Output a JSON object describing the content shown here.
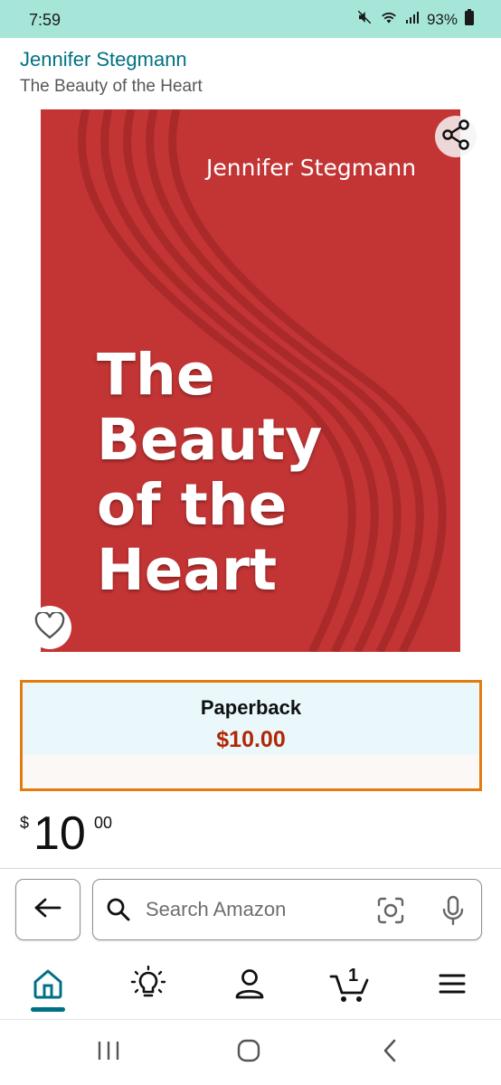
{
  "status_bar": {
    "time": "7:59",
    "battery": "93%",
    "icons": [
      "mute-icon",
      "wifi-icon",
      "signal-icon",
      "battery-icon"
    ],
    "background": "#a6e6d9"
  },
  "product": {
    "author": "Jennifer Stegmann",
    "title": "The Beauty of the Heart",
    "cover": {
      "author": "Jennifer Stegmann",
      "title": "The\nBeauty\nof the\nHeart",
      "background": "#c33434"
    }
  },
  "format": {
    "label": "Paperback",
    "price": "$10.00",
    "border_color": "#e27c0e"
  },
  "price": {
    "symbol": "$",
    "whole": "10",
    "fraction": "00"
  },
  "search": {
    "placeholder": "Search Amazon",
    "value": ""
  },
  "bottom_nav": {
    "items": [
      "home-icon",
      "inspire-icon",
      "account-icon",
      "cart-icon",
      "menu-icon"
    ],
    "cart_count": "1",
    "active": "home-icon",
    "accent": "#007185"
  },
  "system_nav": [
    "recents-icon",
    "home-circle-icon",
    "back-chevron-icon"
  ],
  "colors": {
    "link": "#007185",
    "price": "#b12704",
    "text": "#0f1111"
  }
}
